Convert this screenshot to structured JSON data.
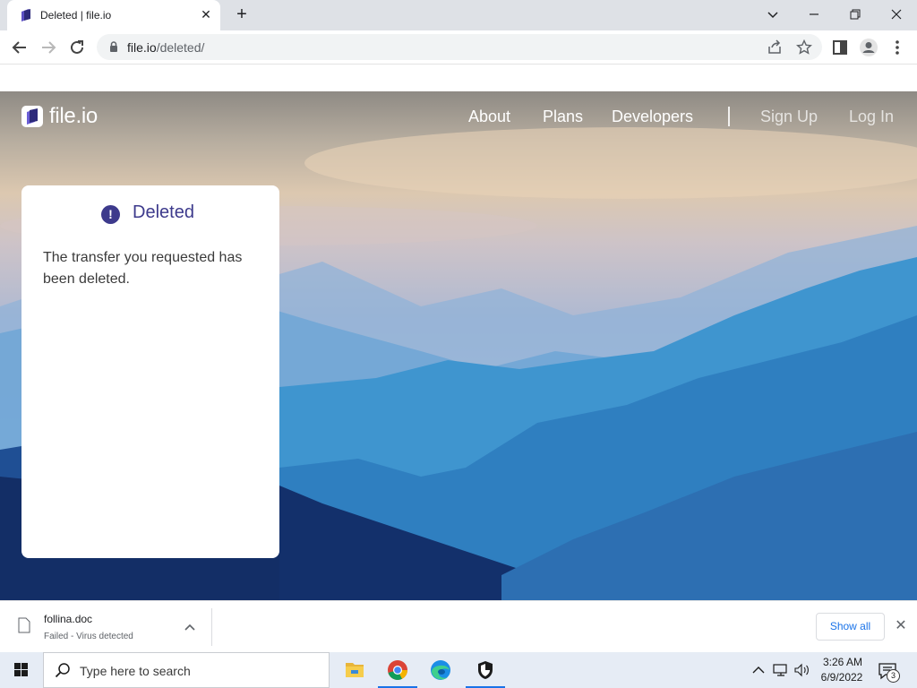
{
  "browser": {
    "tab_title": "Deleted | file.io",
    "url_host": "file.io",
    "url_path": "/deleted/"
  },
  "site": {
    "logo_text": "file.io",
    "nav": [
      "About",
      "Plans",
      "Developers"
    ],
    "auth": [
      "Sign Up",
      "Log In"
    ]
  },
  "card": {
    "title": "Deleted",
    "icon": "!",
    "message": "The transfer you requested has been deleted."
  },
  "download": {
    "filename": "follina.doc",
    "status": "Failed - Virus detected",
    "show_all_label": "Show all"
  },
  "taskbar": {
    "search_placeholder": "Type here to search",
    "time": "3:26 AM",
    "date": "6/9/2022",
    "notification_count": "3"
  },
  "colors": {
    "brand": "#3d3a8c",
    "link": "#1a73e8"
  }
}
